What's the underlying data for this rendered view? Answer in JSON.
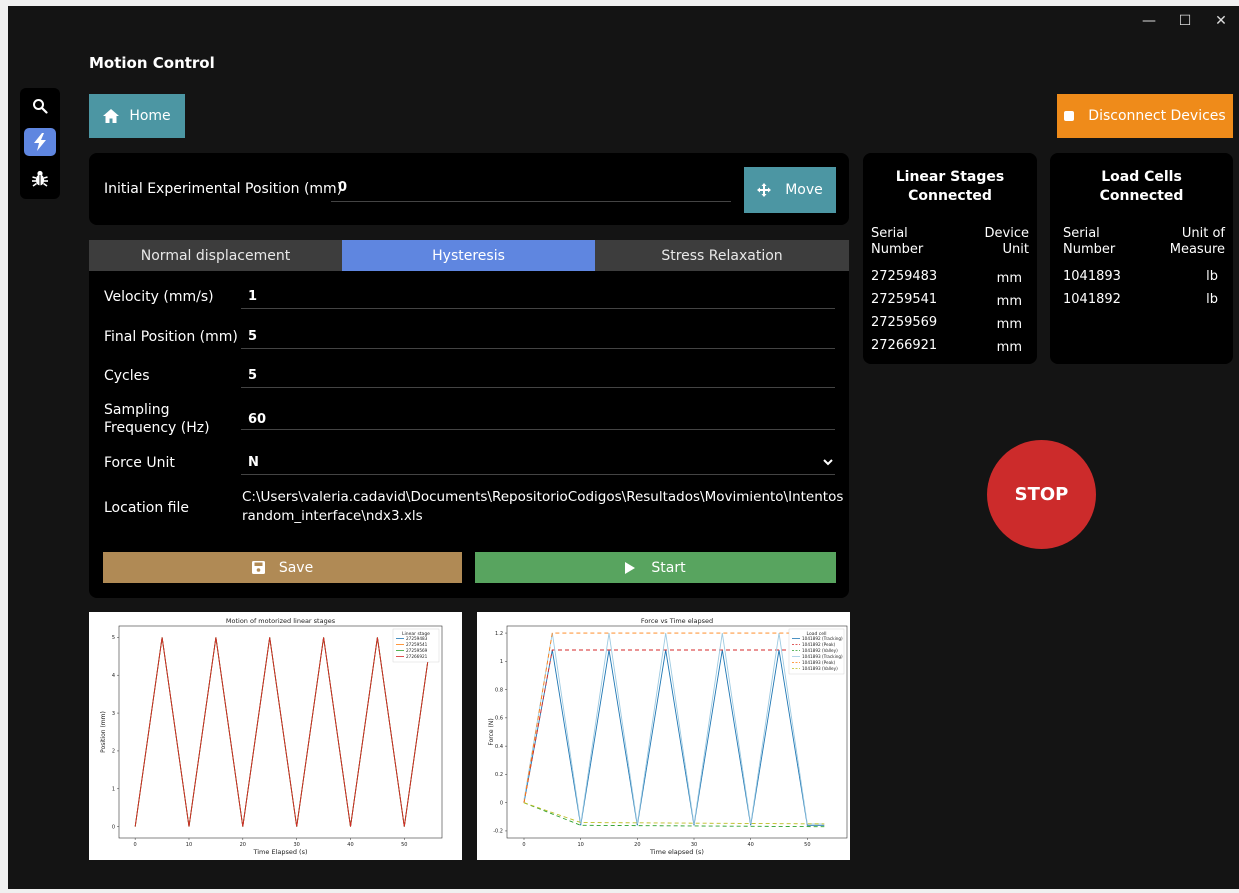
{
  "window": {
    "title": "Motion Control",
    "controls": {
      "minimize": "—",
      "maximize": "☐",
      "close": "✕"
    }
  },
  "sidebar": {
    "items": [
      {
        "name": "search",
        "icon": "search-icon"
      },
      {
        "name": "motion",
        "icon": "lightning-icon",
        "active": true
      },
      {
        "name": "debug",
        "icon": "bug-icon"
      }
    ]
  },
  "header": {
    "home_label": "Home",
    "disconnect_label": "Disconnect Devices"
  },
  "position": {
    "label": "Initial Experimental Position (mm)",
    "value": "0",
    "move_label": "Move"
  },
  "tabs": {
    "normal": "Normal displacement",
    "hysteresis": "Hysteresis",
    "stress": "Stress Relaxation",
    "active": "Hysteresis"
  },
  "form": {
    "velocity_label": "Velocity (mm/s)",
    "velocity_value": "1",
    "final_label": "Final Position (mm)",
    "final_value": "5",
    "cycles_label": "Cycles",
    "cycles_value": "5",
    "sampling_label_1": "Sampling",
    "sampling_label_2": "Frequency (Hz)",
    "sampling_value": "60",
    "force_label": "Force Unit",
    "force_value": "N",
    "location_label": "Location file",
    "location_line1": "C:\\Users\\valeria.cadavid\\Documents\\RepositorioCodigos\\Resultados\\Movimiento\\Intentos",
    "location_line2": "random_interface\\ndx3.xls",
    "save_label": "Save",
    "start_label": "Start"
  },
  "linear_stages": {
    "title_1": "Linear Stages",
    "title_2": "Connected",
    "col1_1": "Serial",
    "col1_2": "Number",
    "col2_1": "Device",
    "col2_2": "Unit",
    "rows": [
      {
        "serial": "27259483",
        "unit": "mm"
      },
      {
        "serial": "27259541",
        "unit": "mm"
      },
      {
        "serial": "27259569",
        "unit": "mm"
      },
      {
        "serial": "27266921",
        "unit": "mm"
      }
    ]
  },
  "load_cells": {
    "title_1": "Load Cells",
    "title_2": "Connected",
    "col1_1": "Serial",
    "col1_2": "Number",
    "col2_1": "Unit of",
    "col2_2": "Measure",
    "rows": [
      {
        "serial": "1041893",
        "unit": "lb"
      },
      {
        "serial": "1041892",
        "unit": "lb"
      }
    ]
  },
  "stop_label": "STOP",
  "colors": {
    "accent_blue": "#5f86e0",
    "teal": "#4c96a3",
    "orange": "#ef8b1a",
    "save": "#b08a55",
    "start": "#58a45f",
    "stop": "#cc2b2b",
    "header_text": "#4fb3c6"
  },
  "chart_data": [
    {
      "type": "line",
      "title": "Motion of motorized linear stages",
      "xlabel": "Time Elapsed (s)",
      "ylabel": "Position (mm)",
      "xlim": [
        -3,
        57
      ],
      "ylim": [
        -0.3,
        5.3
      ],
      "xticks": [
        0,
        10,
        20,
        30,
        40,
        50
      ],
      "yticks": [
        0,
        1,
        2,
        3,
        4,
        5
      ],
      "legend_title": "Linear stage",
      "legend_position": "top-right",
      "x": [
        0,
        5,
        10,
        15,
        20,
        25,
        30,
        35,
        40,
        45,
        50,
        55
      ],
      "series": [
        {
          "name": "27259483",
          "color": "#1f77b4",
          "values": [
            0,
            5,
            0,
            5,
            0,
            5,
            0,
            5,
            0,
            5,
            0,
            5
          ]
        },
        {
          "name": "27259541",
          "color": "#ff7f0e",
          "values": [
            0,
            5,
            0,
            5,
            0,
            5,
            0,
            5,
            0,
            5,
            0,
            5
          ]
        },
        {
          "name": "27259569",
          "color": "#2ca02c",
          "values": [
            0,
            5,
            0,
            5,
            0,
            5,
            0,
            5,
            0,
            5,
            0,
            5
          ]
        },
        {
          "name": "27266921",
          "color": "#d62728",
          "values": [
            0,
            5,
            0,
            5,
            0,
            5,
            0,
            5,
            0,
            5,
            0,
            5
          ]
        }
      ]
    },
    {
      "type": "line",
      "title": "Force vs Time elapsed",
      "xlabel": "Time elapsed (s)",
      "ylabel": "Force (N)",
      "xlim": [
        -3,
        57
      ],
      "ylim": [
        -0.25,
        1.25
      ],
      "xticks": [
        0,
        10,
        20,
        30,
        40,
        50
      ],
      "yticks": [
        -0.2,
        0.0,
        0.2,
        0.4,
        0.6,
        0.8,
        1.0,
        1.2
      ],
      "legend_title": "Load cell",
      "legend_position": "top-right",
      "series": [
        {
          "name": "1041892 (Tracking)",
          "color": "#1f77b4",
          "dash": "none",
          "x": [
            0,
            5,
            10,
            15,
            20,
            25,
            30,
            35,
            40,
            45,
            50,
            53
          ],
          "values": [
            0,
            1.08,
            -0.16,
            1.08,
            -0.16,
            1.08,
            -0.16,
            1.08,
            -0.16,
            1.08,
            -0.16,
            -0.16
          ]
        },
        {
          "name": "1041892 (Peak)",
          "color": "#d62728",
          "dash": "4,3",
          "x": [
            0,
            5,
            53
          ],
          "values": [
            0,
            1.08,
            1.08
          ]
        },
        {
          "name": "1041892 (Valley)",
          "color": "#2ca02c",
          "dash": "4,3",
          "x": [
            0,
            10,
            53
          ],
          "values": [
            0,
            -0.16,
            -0.17
          ]
        },
        {
          "name": "1041893 (Tracking)",
          "color": "#9ecae1",
          "dash": "none",
          "x": [
            0,
            5,
            10,
            15,
            20,
            25,
            30,
            35,
            40,
            45,
            50,
            53
          ],
          "values": [
            0.02,
            1.2,
            -0.15,
            1.2,
            -0.15,
            1.2,
            -0.15,
            1.2,
            -0.15,
            1.2,
            -0.15,
            -0.15
          ]
        },
        {
          "name": "1041893 (Peak)",
          "color": "#ff7f0e",
          "dash": "4,3",
          "x": [
            0,
            5,
            53
          ],
          "values": [
            0,
            1.2,
            1.2
          ]
        },
        {
          "name": "1041893 (Valley)",
          "color": "#bcbd22",
          "dash": "4,3",
          "x": [
            0,
            10,
            53
          ],
          "values": [
            0,
            -0.14,
            -0.15
          ]
        }
      ]
    }
  ]
}
